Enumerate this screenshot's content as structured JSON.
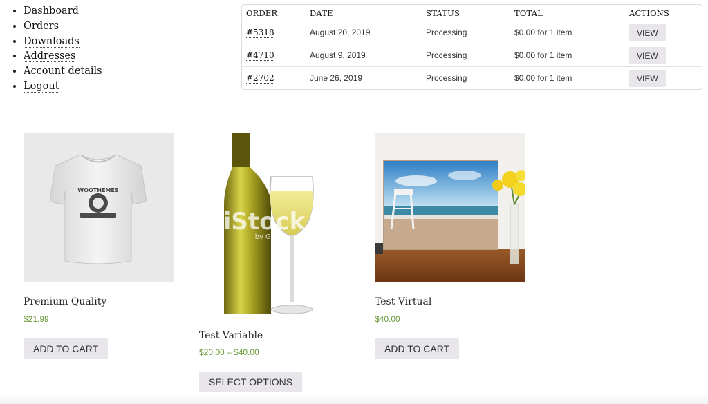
{
  "account_nav": {
    "items": [
      {
        "label": "Dashboard"
      },
      {
        "label": "Orders"
      },
      {
        "label": "Downloads"
      },
      {
        "label": "Addresses"
      },
      {
        "label": "Account details"
      },
      {
        "label": "Logout"
      }
    ]
  },
  "orders": {
    "headers": {
      "order": "ORDER",
      "date": "DATE",
      "status": "STATUS",
      "total": "TOTAL",
      "actions": "ACTIONS"
    },
    "rows": [
      {
        "number": "#5318",
        "date": "August 20, 2019",
        "status": "Processing",
        "total": "$0.00 for 1 item",
        "action": "VIEW"
      },
      {
        "number": "#4710",
        "date": "August 9, 2019",
        "status": "Processing",
        "total": "$0.00 for 1 item",
        "action": "VIEW"
      },
      {
        "number": "#2702",
        "date": "June 26, 2019",
        "status": "Processing",
        "total": "$0.00 for 1 item",
        "action": "VIEW"
      }
    ]
  },
  "products": [
    {
      "title": "Premium Quality",
      "price": "$21.99",
      "button": "ADD TO CART",
      "image": "tshirt-icon",
      "tshirt_text": "WOOTHEMES"
    },
    {
      "title": "Test Variable",
      "price": "$20.00 – $40.00",
      "button": "SELECT OPTIONS",
      "image": "wine-icon",
      "watermark": "iStock",
      "watermark_sub": "by Getty Images"
    },
    {
      "title": "Test Virtual",
      "price": "$40.00",
      "button": "ADD TO CART",
      "image": "beach-canvas-icon"
    }
  ],
  "colors": {
    "price": "#6a9a3a",
    "button_bg": "#e8e6ea",
    "table_border": "#dcdcdc"
  }
}
